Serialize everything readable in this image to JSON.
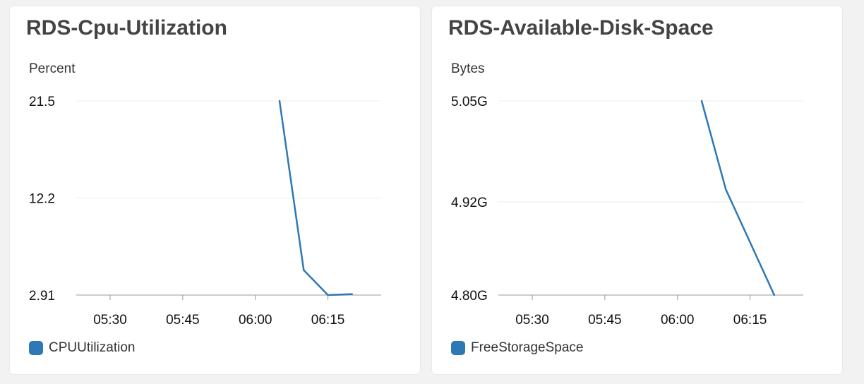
{
  "colors": {
    "series": "#2e78b5",
    "grid": "#ececec",
    "axis": "#cccccc"
  },
  "panels": [
    {
      "title": "RDS-Cpu-Utilization",
      "legend_icon": "rounded-square-swatch",
      "legend": "CPUUtilization",
      "chart_data": {
        "type": "line",
        "title": "RDS-Cpu-Utilization",
        "ylabel": "Percent",
        "xlabel": "",
        "yticks": [
          "21.5",
          "12.2",
          "2.91"
        ],
        "ylim": [
          2.91,
          21.5
        ],
        "xticks": [
          "05:30",
          "05:45",
          "06:00",
          "06:15"
        ],
        "xlim": [
          "05:23",
          "06:26"
        ],
        "grid": true,
        "legend_position": "bottom-left",
        "series": [
          {
            "name": "CPUUtilization",
            "x": [
              "06:05",
              "06:10",
              "06:15",
              "06:20"
            ],
            "y": [
              21.5,
              5.3,
              2.91,
              3.0
            ]
          }
        ]
      }
    },
    {
      "title": "RDS-Available-Disk-Space",
      "legend_icon": "rounded-square-swatch",
      "legend": "FreeStorageSpace",
      "chart_data": {
        "type": "line",
        "title": "RDS-Available-Disk-Space",
        "ylabel": "Bytes",
        "xlabel": "",
        "yticks": [
          "5.05G",
          "4.92G",
          "4.80G"
        ],
        "ylim": [
          4.8,
          5.05
        ],
        "xticks": [
          "05:30",
          "05:45",
          "06:00",
          "06:15"
        ],
        "xlim": [
          "05:23",
          "06:26"
        ],
        "grid": true,
        "legend_position": "bottom-left",
        "series": [
          {
            "name": "FreeStorageSpace",
            "x": [
              "06:05",
              "06:10",
              "06:20"
            ],
            "y": [
              5.05,
              4.936,
              4.8
            ]
          }
        ]
      }
    }
  ]
}
